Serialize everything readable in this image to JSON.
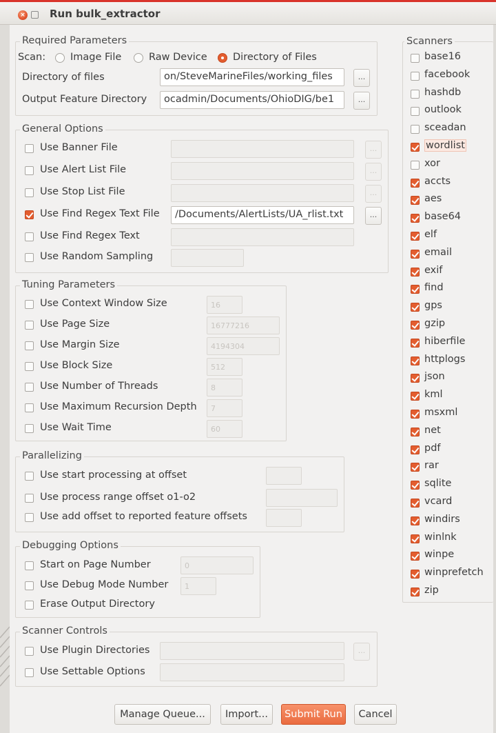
{
  "window": {
    "title": "Run bulk_extractor"
  },
  "required": {
    "title": "Required Parameters",
    "scan_label": "Scan:",
    "scan_options": [
      "Image File",
      "Raw Device",
      "Directory of Files"
    ],
    "scan_selected": "Directory of Files",
    "directory_label": "Directory of files",
    "directory_value": "on/SteveMarineFiles/working_files",
    "output_label": "Output Feature Directory",
    "output_value": "ocadmin/Documents/OhioDIG/be1",
    "browse": "..."
  },
  "general": {
    "title": "General Options",
    "items": [
      {
        "label": "Use Banner File",
        "checked": false,
        "value": ""
      },
      {
        "label": "Use Alert List File",
        "checked": false,
        "value": ""
      },
      {
        "label": "Use Stop List File",
        "checked": false,
        "value": ""
      },
      {
        "label": "Use Find Regex Text File",
        "checked": true,
        "value": "/Documents/AlertLists/UA_rlist.txt"
      },
      {
        "label": "Use Find Regex Text",
        "checked": false,
        "value": ""
      },
      {
        "label": "Use Random Sampling",
        "checked": false,
        "value": ""
      }
    ]
  },
  "tuning": {
    "title": "Tuning Parameters",
    "items": [
      {
        "label": "Use Context Window Size",
        "checked": false,
        "value": "16"
      },
      {
        "label": "Use Page Size",
        "checked": false,
        "value": "16777216"
      },
      {
        "label": "Use Margin Size",
        "checked": false,
        "value": "4194304"
      },
      {
        "label": "Use Block Size",
        "checked": false,
        "value": "512"
      },
      {
        "label": "Use Number of Threads",
        "checked": false,
        "value": "8"
      },
      {
        "label": "Use Maximum Recursion Depth",
        "checked": false,
        "value": "7"
      },
      {
        "label": "Use Wait Time",
        "checked": false,
        "value": "60"
      }
    ]
  },
  "parallel": {
    "title": "Parallelizing",
    "items": [
      {
        "label": "Use start processing at offset",
        "checked": false,
        "value": ""
      },
      {
        "label": "Use process range offset o1-o2",
        "checked": false,
        "value": ""
      },
      {
        "label": "Use add offset to reported feature offsets",
        "checked": false,
        "value": ""
      }
    ]
  },
  "debug": {
    "title": "Debugging Options",
    "items": [
      {
        "label": "Start on Page Number",
        "checked": false,
        "value": "0"
      },
      {
        "label": "Use Debug Mode Number",
        "checked": false,
        "value": "1"
      },
      {
        "label": "Erase Output Directory",
        "checked": false,
        "value": ""
      }
    ]
  },
  "controls": {
    "title": "Scanner Controls",
    "items": [
      {
        "label": "Use Plugin Directories",
        "checked": false,
        "value": ""
      },
      {
        "label": "Use Settable Options",
        "checked": false,
        "value": ""
      }
    ]
  },
  "scanners": {
    "title": "Scanners",
    "items": [
      {
        "name": "base16",
        "checked": false
      },
      {
        "name": "facebook",
        "checked": false
      },
      {
        "name": "hashdb",
        "checked": false
      },
      {
        "name": "outlook",
        "checked": false
      },
      {
        "name": "sceadan",
        "checked": false
      },
      {
        "name": "wordlist",
        "checked": true,
        "highlighted": true
      },
      {
        "name": "xor",
        "checked": false
      },
      {
        "name": "accts",
        "checked": true
      },
      {
        "name": "aes",
        "checked": true
      },
      {
        "name": "base64",
        "checked": true
      },
      {
        "name": "elf",
        "checked": true
      },
      {
        "name": "email",
        "checked": true
      },
      {
        "name": "exif",
        "checked": true
      },
      {
        "name": "find",
        "checked": true
      },
      {
        "name": "gps",
        "checked": true
      },
      {
        "name": "gzip",
        "checked": true
      },
      {
        "name": "hiberfile",
        "checked": true
      },
      {
        "name": "httplogs",
        "checked": true
      },
      {
        "name": "json",
        "checked": true
      },
      {
        "name": "kml",
        "checked": true
      },
      {
        "name": "msxml",
        "checked": true
      },
      {
        "name": "net",
        "checked": true
      },
      {
        "name": "pdf",
        "checked": true
      },
      {
        "name": "rar",
        "checked": true
      },
      {
        "name": "sqlite",
        "checked": true
      },
      {
        "name": "vcard",
        "checked": true
      },
      {
        "name": "windirs",
        "checked": true
      },
      {
        "name": "winlnk",
        "checked": true
      },
      {
        "name": "winpe",
        "checked": true
      },
      {
        "name": "winprefetch",
        "checked": true
      },
      {
        "name": "zip",
        "checked": true
      }
    ]
  },
  "buttons": {
    "manage_queue": "Manage Queue...",
    "import": "Import...",
    "submit": "Submit Run",
    "cancel": "Cancel"
  },
  "colors": {
    "accent": "#e35d2f",
    "title_line": "#d9342b"
  }
}
